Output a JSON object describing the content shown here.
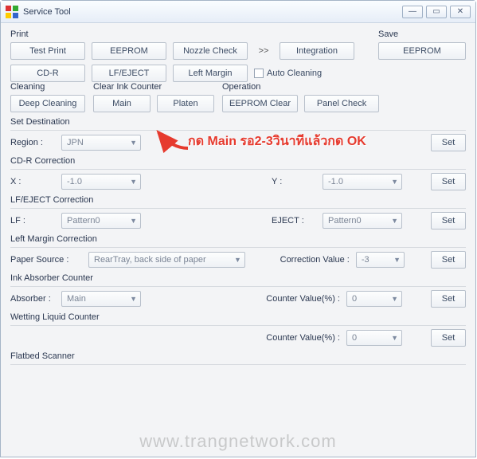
{
  "window": {
    "title": "Service Tool"
  },
  "print": {
    "label": "Print",
    "test_print": "Test Print",
    "eeprom": "EEPROM",
    "nozzle_check": "Nozzle Check",
    "integration": "Integration",
    "cdr": "CD-R",
    "lf_eject": "LF/EJECT",
    "left_margin": "Left Margin",
    "auto_cleaning": "Auto Cleaning"
  },
  "save": {
    "label": "Save",
    "eeprom": "EEPROM"
  },
  "cleaning": {
    "label": "Cleaning",
    "deep_cleaning": "Deep Cleaning"
  },
  "clear_ink": {
    "label": "Clear Ink Counter",
    "main": "Main",
    "platen": "Platen"
  },
  "operation": {
    "label": "Operation",
    "eeprom_clear": "EEPROM Clear",
    "panel_check": "Panel Check"
  },
  "set_destination": {
    "label": "Set Destination",
    "region_label": "Region :",
    "region_value": "JPN"
  },
  "cdr_correction": {
    "label": "CD-R Correction",
    "x_label": "X :",
    "x_value": "-1.0",
    "y_label": "Y :",
    "y_value": "-1.0"
  },
  "lf_eject_correction": {
    "label": "LF/EJECT Correction",
    "lf_label": "LF :",
    "lf_value": "Pattern0",
    "eject_label": "EJECT :",
    "eject_value": "Pattern0"
  },
  "left_margin_correction": {
    "label": "Left Margin Correction",
    "paper_source_label": "Paper Source :",
    "paper_source_value": "RearTray, back side of paper",
    "correction_value_label": "Correction Value :",
    "correction_value": "-3"
  },
  "ink_absorber": {
    "label": "Ink Absorber Counter",
    "absorber_label": "Absorber :",
    "absorber_value": "Main",
    "counter_label": "Counter Value(%) :",
    "counter_value": "0"
  },
  "wetting": {
    "label": "Wetting Liquid Counter",
    "counter_label": "Counter Value(%) :",
    "counter_value": "0"
  },
  "flatbed": {
    "label": "Flatbed Scanner"
  },
  "common": {
    "set": "Set",
    "arrows": ">>"
  },
  "annotation": {
    "text": "กด Main รอ2-3วินาทีแล้วกด OK"
  },
  "watermark": "www.trangnetwork.com"
}
